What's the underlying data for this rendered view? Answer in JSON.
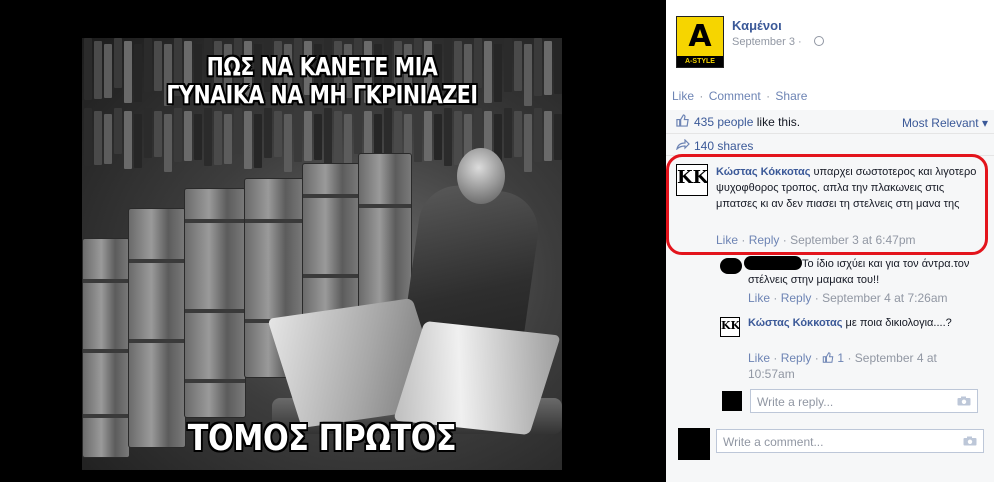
{
  "photo": {
    "meme_top_line1": "ΠΩΣ ΝΑ ΚΑΝΕΤΕ ΜΙΑ",
    "meme_top_line2": "ΓΥΝΑΙΚΑ ΝΑ ΜΗ ΓΚΡΙΝΙΑΖΕΙ",
    "meme_bottom": "ΤΟΜΟΣ ΠΡΩΤΟΣ"
  },
  "post": {
    "page_name": "Καμένοι",
    "page_logo_text": "A-STYLE",
    "date": "September 3 ·",
    "privacy_icon": "globe-icon"
  },
  "actions": {
    "like": "Like",
    "comment": "Comment",
    "share": "Share",
    "separator": "·"
  },
  "feedback": {
    "likes_count": "435 people",
    "likes_suffix": "like this.",
    "sort": "Most Relevant ▾",
    "shares": "140 shares"
  },
  "comments": [
    {
      "author": "Κώστας Κόκκοτας",
      "text": " υπαρχει σωστοτερος και λιγοτερο ψυχοφθορος τροπος. απλα την πλακωνεις στις μπατσες κι αν δεν πιασει τη στελνεις στη μανα της",
      "like": "Like",
      "reply": "Reply",
      "time": "September 3 at 6:47pm",
      "avatar_text": "KK"
    }
  ],
  "replies": [
    {
      "author": "",
      "text": "Το ίδιο ισχύει και για τον άντρα.τον στέλνεις στην μαμακα του!!",
      "like": "Like",
      "reply": "Reply",
      "time": "September 4 at 7:26am"
    },
    {
      "author": "Κώστας Κόκκοτας",
      "text": " με ποια δικιολογια....?",
      "like": "Like",
      "reply": "Reply",
      "likes": "1",
      "time_line1": "September 4 at",
      "time_line2": "10:57am",
      "avatar_text": "KK"
    }
  ],
  "reply_input": {
    "placeholder": "Write a reply..."
  },
  "comment_input": {
    "placeholder": "Write a comment..."
  },
  "colors": {
    "facebook_blue": "#3b5998",
    "link": "#6d84b4",
    "highlight_ring": "#e3141c",
    "logo_yellow": "#f6d500"
  }
}
